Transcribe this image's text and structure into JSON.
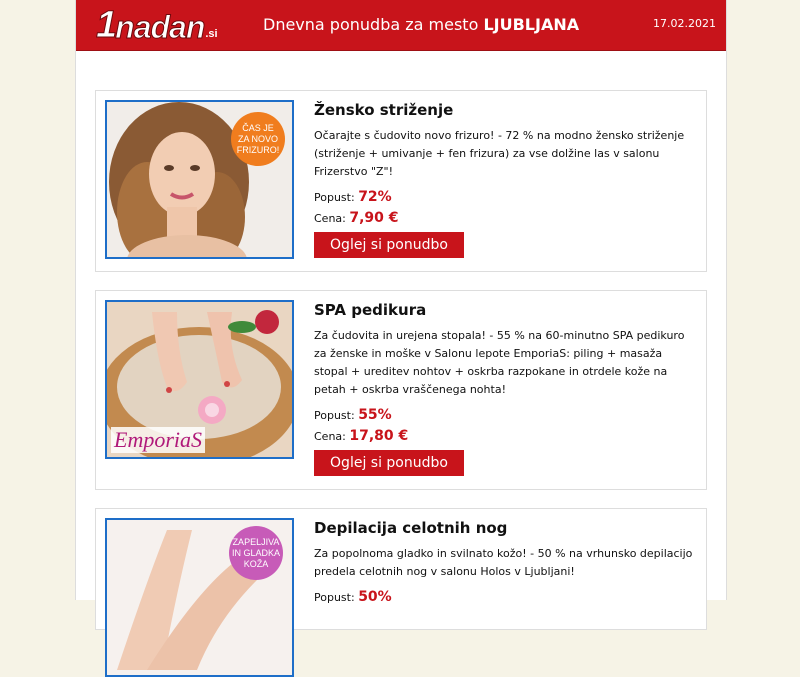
{
  "header": {
    "logo_number": "1",
    "logo_word": "nadan",
    "logo_tld": ".si",
    "title_prefix": "Dnevna ponudba za mesto",
    "title_city": "LJUBLJANA",
    "date": "17.02.2021"
  },
  "colors": {
    "brand_red": "#c8141b",
    "thumb_border": "#1e6ec8"
  },
  "offers": [
    {
      "title": "Žensko striženje",
      "description": "Očarajte s čudovito novo frizuro! - 72 % na modno žensko striženje (striženje + umivanje + fen frizura) za vse dolžine las v salonu Frizerstvo \"Z\"!",
      "discount_label": "Popust:",
      "discount": "72%",
      "price_label": "Cena:",
      "price": "7,90 €",
      "button": "Oglej si ponudbo",
      "badge": [
        "ČAS JE",
        "ZA NOVO",
        "FRIZURO!"
      ]
    },
    {
      "title": "SPA pedikura",
      "description": "Za čudovita in urejena stopala! - 55 % na 60-minutno SPA pedikuro za ženske in moške v Salonu lepote EmporiaS: piling + masaža stopal + ureditev nohtov + oskrba razpokane in otrdele kože na petah + oskrba vraščenega nohta!",
      "discount_label": "Popust:",
      "discount": "55%",
      "price_label": "Cena:",
      "price": "17,80 €",
      "button": "Oglej si ponudbo",
      "logo_text": "Emporia",
      "logo_accent": "S"
    },
    {
      "title": "Depilacija celotnih nog",
      "description": "Za popolnoma gladko in svilnato kožo! - 50 % na vrhunsko depilacijo predela celotnih nog v salonu Holos v Ljubljani!",
      "discount_label": "Popust:",
      "discount": "50%",
      "badge": [
        "ZAPELJIVA",
        "IN GLADKA",
        "KOŽA"
      ]
    }
  ]
}
